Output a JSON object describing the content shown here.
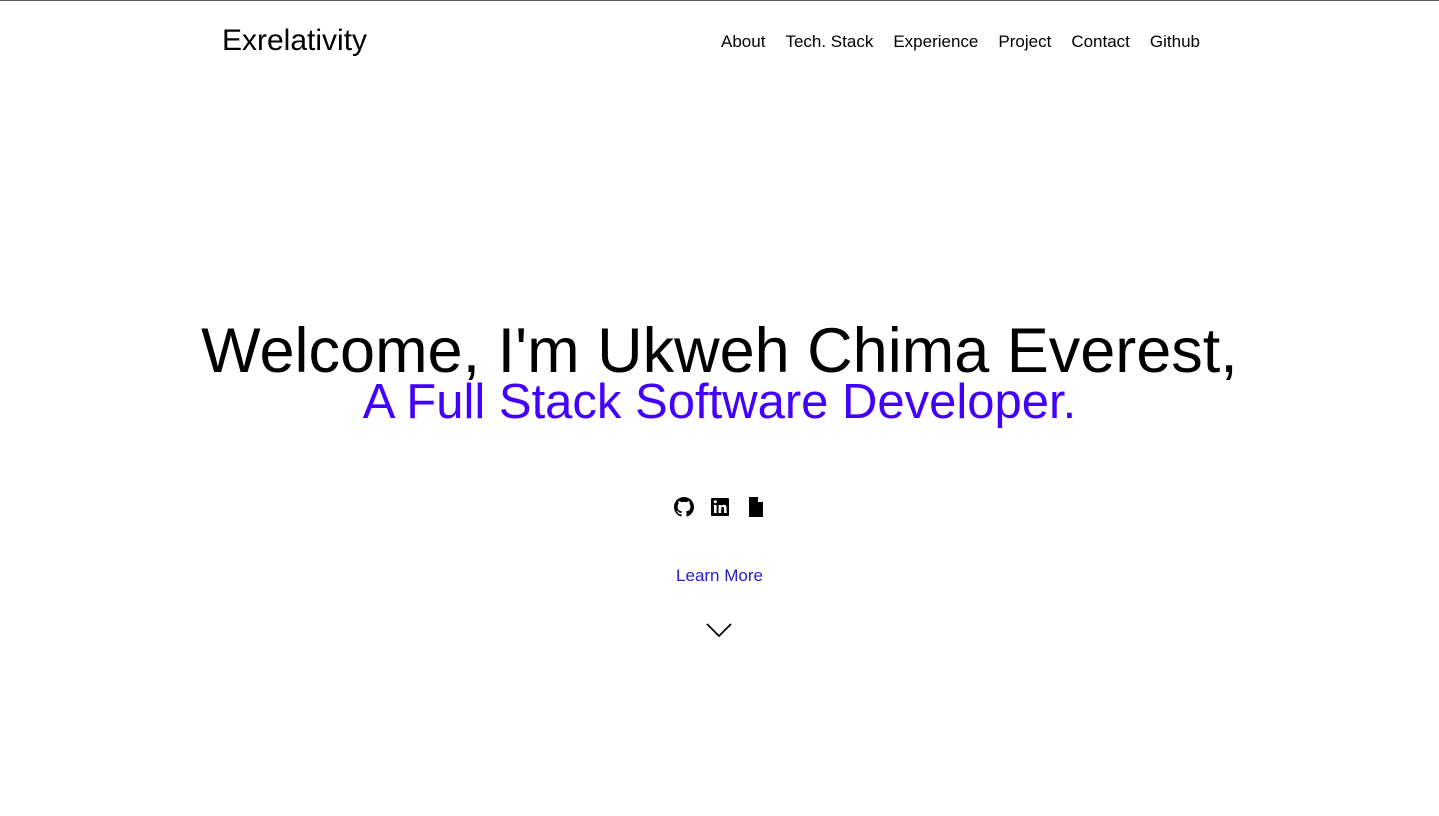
{
  "header": {
    "brand": "Exrelativity",
    "nav": [
      "About",
      "Tech. Stack",
      "Experience",
      "Project",
      "Contact",
      "Github"
    ]
  },
  "hero": {
    "title": "Welcome, I'm Ukweh Chima Everest,",
    "subtitle": "A Full Stack Software Developer."
  },
  "socials": [
    {
      "icon": "github-icon"
    },
    {
      "icon": "linkedin-icon"
    },
    {
      "icon": "document-icon"
    }
  ],
  "cta": {
    "learn_more": "Learn More",
    "icon": "chevron-down-icon"
  },
  "colors": {
    "accent": "#4200ff",
    "link": "#2a1bd1",
    "text": "#000000",
    "background": "#ffffff"
  }
}
